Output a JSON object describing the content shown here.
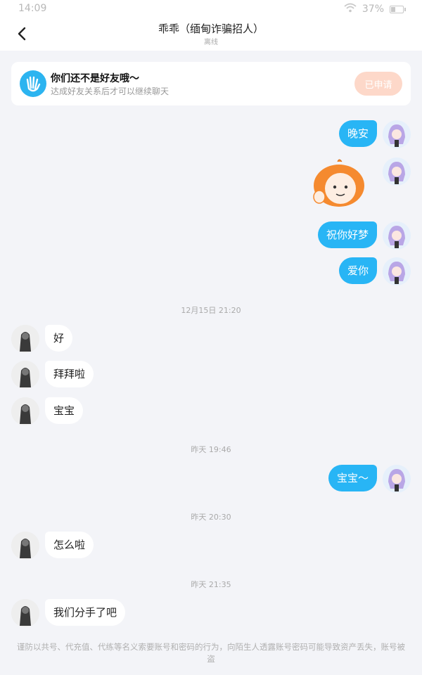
{
  "status_bar": {
    "time": "14:09",
    "battery": "37%",
    "battery_level": 0.37
  },
  "header": {
    "title": "乖乖（缅甸诈骗招人）",
    "subtitle": "离线"
  },
  "friend_notice": {
    "title": "你们还不是好友哦～",
    "subtitle": "达成好友关系后才可以继续聊天",
    "button_label": "已申请"
  },
  "messages": [
    {
      "text": "晚安"
    },
    {
      "text": ""
    },
    {
      "text": "祝你好梦"
    },
    {
      "text": "爱你"
    },
    {
      "text": "好"
    },
    {
      "text": "拜拜啦"
    },
    {
      "text": "宝宝"
    },
    {
      "text": "宝宝～"
    },
    {
      "text": "怎么啦"
    },
    {
      "text": "我们分手了吧"
    }
  ],
  "timestamps": [
    "12月15日 21:20",
    "昨天 19:46",
    "昨天 20:30",
    "昨天 21:35"
  ],
  "footer": {
    "warning": "谨防以共号、代充值、代练等名义索要账号和密码的行为，向陌生人透露账号密码可能导致资产丢失，账号被盗"
  },
  "colors": {
    "outgoing_bubble": "#28b5f5",
    "incoming_bubble": "#ffffff",
    "applied_button": "#fdd8c9",
    "background": "#f3f4f8"
  }
}
